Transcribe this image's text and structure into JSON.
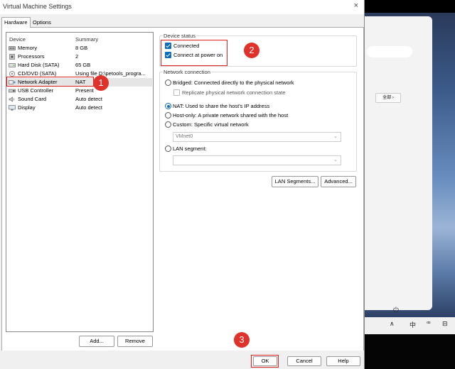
{
  "window": {
    "title": "Virtual Machine Settings",
    "close_icon": "×"
  },
  "tabs": [
    {
      "label": "Hardware",
      "active": true
    },
    {
      "label": "Options",
      "active": false
    }
  ],
  "device_list": {
    "headers": {
      "device": "Device",
      "summary": "Summary"
    },
    "rows": [
      {
        "icon": "memory-icon",
        "name": "Memory",
        "summary": "8 GB",
        "selected": false
      },
      {
        "icon": "processor-icon",
        "name": "Processors",
        "summary": "2",
        "selected": false
      },
      {
        "icon": "harddisk-icon",
        "name": "Hard Disk (SATA)",
        "summary": "65 GB",
        "selected": false
      },
      {
        "icon": "cdrom-icon",
        "name": "CD/DVD (SATA)",
        "summary": "Using file D:\\petools_progra...",
        "selected": false
      },
      {
        "icon": "network-adapter-icon",
        "name": "Network Adapter",
        "summary": "NAT",
        "selected": true
      },
      {
        "icon": "usb-icon",
        "name": "USB Controller",
        "summary": "Present",
        "selected": false
      },
      {
        "icon": "sound-card-icon",
        "name": "Sound Card",
        "summary": "Auto detect",
        "selected": false
      },
      {
        "icon": "display-icon",
        "name": "Display",
        "summary": "Auto detect",
        "selected": false
      }
    ],
    "add_button": "Add...",
    "remove_button": "Remove"
  },
  "device_status": {
    "label": "Device status",
    "connected": {
      "label": "Connected",
      "checked": true
    },
    "connect_at_power_on": {
      "label": "Connect at power on",
      "checked": true
    }
  },
  "network_connection": {
    "label": "Network connection",
    "bridged": {
      "label": "Bridged: Connected directly to the physical network",
      "selected": false
    },
    "replicate": {
      "label": "Replicate physical network connection state",
      "checked": false
    },
    "nat": {
      "label": "NAT: Used to share the host's IP address",
      "selected": true
    },
    "host_only": {
      "label": "Host-only: A private network shared with the host",
      "selected": false
    },
    "custom": {
      "label": "Custom: Specific virtual network",
      "selected": false
    },
    "vmnet_value": "VMnet0",
    "lan_segment": {
      "label": "LAN segment:",
      "selected": false
    },
    "lan_segment_value": ""
  },
  "buttons": {
    "lan_segments": "LAN Segments...",
    "advanced": "Advanced...",
    "ok": "OK",
    "cancel": "Cancel",
    "help": "Help"
  },
  "annotations": [
    "1",
    "2",
    "3"
  ],
  "background_window": {
    "chip_label": "全部 ›",
    "taskbar": [
      "∧",
      "中",
      "ꟹ",
      "⊟"
    ],
    "power_icon": "⏻"
  }
}
